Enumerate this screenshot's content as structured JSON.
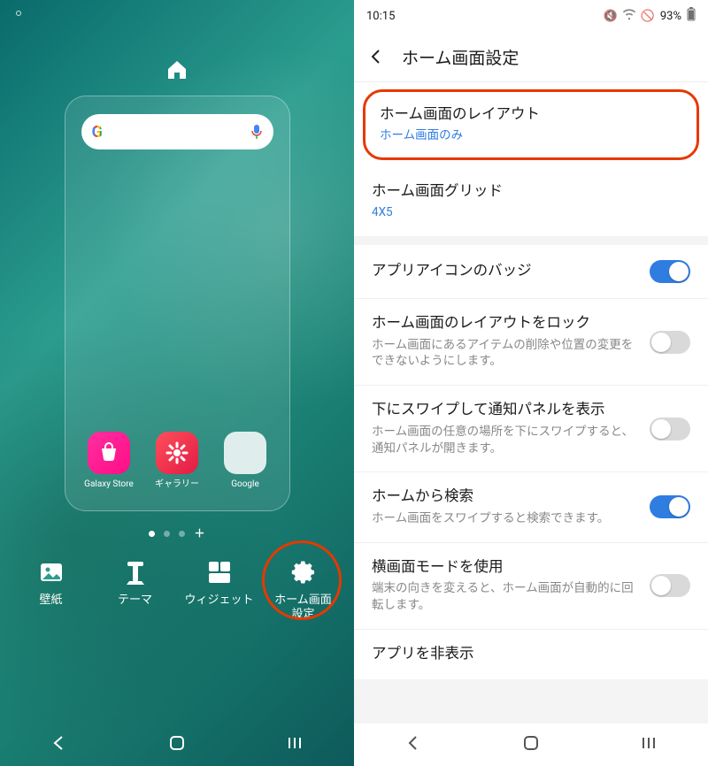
{
  "left": {
    "dock_apps": [
      {
        "name": "galaxy-store",
        "label": "Galaxy Store"
      },
      {
        "name": "gallery",
        "label": "ギャラリー"
      },
      {
        "name": "google-folder",
        "label": "Google"
      }
    ],
    "page_indicator": {
      "total": 3,
      "active": 0,
      "has_plus": true
    },
    "actions": {
      "wallpaper": "壁紙",
      "theme": "テーマ",
      "widget": "ウィジェット",
      "home_settings": "ホーム画面\n設定"
    }
  },
  "right": {
    "status": {
      "time": "10:15",
      "battery_pct": "93%"
    },
    "header": {
      "title": "ホーム画面設定"
    },
    "items": {
      "layout": {
        "title": "ホーム画面のレイアウト",
        "sub": "ホーム画面のみ"
      },
      "grid": {
        "title": "ホーム画面グリッド",
        "sub": "4X5"
      },
      "badge": {
        "title": "アプリアイコンのバッジ",
        "on": true
      },
      "lock": {
        "title": "ホーム画面のレイアウトをロック",
        "sub": "ホーム画面にあるアイテムの削除や位置の変更をできないようにします。",
        "on": false
      },
      "swipe_panel": {
        "title": "下にスワイプして通知パネルを表示",
        "sub": "ホーム画面の任意の場所を下にスワイプすると、通知パネルが開きます。",
        "on": false
      },
      "search": {
        "title": "ホームから検索",
        "sub": "ホーム画面をスワイプすると検索できます。",
        "on": true
      },
      "landscape": {
        "title": "横画面モードを使用",
        "sub": "端末の向きを変えると、ホーム画面が自動的に回転します。",
        "on": false
      },
      "hide_apps": {
        "title": "アプリを非表示"
      }
    }
  },
  "colors": {
    "highlight": "#e53900",
    "accent_blue": "#2f7de1"
  }
}
